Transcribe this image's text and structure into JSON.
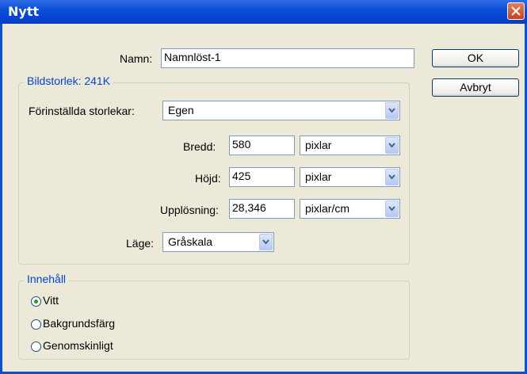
{
  "window": {
    "title": "Nytt"
  },
  "name": {
    "label": "Namn:",
    "value": "Namnlöst-1"
  },
  "buttons": {
    "ok": "OK",
    "cancel": "Avbryt"
  },
  "image_size": {
    "legend": "Bildstorlek: 241K",
    "preset_label": "Förinställda storlekar:",
    "preset_value": "Egen",
    "width_label": "Bredd:",
    "width_value": "580",
    "width_unit": "pixlar",
    "height_label": "Höjd:",
    "height_value": "425",
    "height_unit": "pixlar",
    "resolution_label": "Upplösning:",
    "resolution_value": "28,346",
    "resolution_unit": "pixlar/cm",
    "mode_label": "Läge:",
    "mode_value": "Gråskala"
  },
  "contents": {
    "legend": "Innehåll",
    "options": [
      {
        "label": "Vitt",
        "selected": true
      },
      {
        "label": "Bakgrundsfärg",
        "selected": false
      },
      {
        "label": "Genomskinligt",
        "selected": false
      }
    ]
  },
  "colors": {
    "titlebar": "#0A4FD8",
    "legend": "#0046D5",
    "window_bg": "#ECE9D8"
  }
}
